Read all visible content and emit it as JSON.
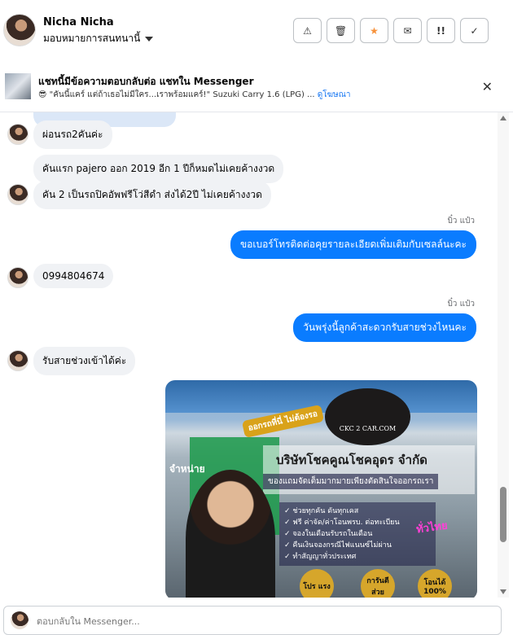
{
  "header": {
    "contact_name": "Nicha Nicha",
    "assign_label": "มอบหมายการสนทนานี้",
    "actions": [
      {
        "icon": "warning-icon",
        "glyph": "⚠"
      },
      {
        "icon": "trash-icon",
        "glyph": "🗑"
      },
      {
        "icon": "star-icon",
        "glyph": "★"
      },
      {
        "icon": "envelope-open-icon",
        "glyph": "✉"
      },
      {
        "icon": "mark-follow-up-icon",
        "glyph": "!!"
      },
      {
        "icon": "check-icon",
        "glyph": "✓"
      }
    ],
    "star_color": "#f7923b"
  },
  "banner": {
    "title": "แชทนี้มีข้อความตอบกลับต่อ แชทใน Messenger",
    "subtitle": "😎 \"คันนี้แคร์ แต่ถ้าเธอไม่มีใคร...เราพร้อมแคร์!\" Suzuki Carry 1.6 (LPG) ...",
    "link": "ดูโฆษณา",
    "close_glyph": "✕"
  },
  "messages": [
    {
      "text": "ผ่อนรถ2คันค่ะ"
    },
    {
      "text": "คันแรก pajero ออก 2019 อีก 1 ปีก็หมดไม่เคยค้างงวด"
    },
    {
      "text": "คัน 2 เป็นรถปิคอัพฟรีโว่สีดำ ส่งได้2ปี ไม่เคยค้างงวด"
    },
    {
      "sender": "บิ๋ว แป๋ว",
      "text": "ขอเบอร์โทรติดต่อคุยรายละเอียดเพิ่มเติมกับเซลล์นะคะ"
    },
    {
      "text": "0994804674"
    },
    {
      "sender": "บิ๋ว แป๋ว",
      "text": "วันพรุ่งนี้ลูกค้าสะดวกรับสายช่วงไหนคะ"
    },
    {
      "text": "รับสายช่วงเข้าได้ค่ะ"
    }
  ],
  "ad_image": {
    "logo_text": "CKC 2 CAR.COM",
    "headline": "บริษัทโชคคูณโชคอุดร จำกัด",
    "tagline": "ของแถมจัดเต็มมากมายเพียงตัดสินใจออกรถเรา",
    "badge": "ออกรถที่นี่ ไม่ต้องรอ",
    "side_text": "จำหน่าย",
    "bullets": [
      "ช่วยทุกคัน ดันทุกเคส",
      "ฟรี ค่าจัด/ค่าโอนพรบ. ต่อทะเบียน",
      "จองในเดือนรับรถในเดือน",
      "คืนเงินจองกรณีไฟแนนซ์ไม่ผ่าน",
      "ทำสัญญาทั่วประเทศ"
    ],
    "chips": [
      "โปร แรง",
      "การันตี ส่วย",
      "โอนได้ 100%"
    ],
    "purple_text": "ทั่วไทย"
  },
  "composer": {
    "placeholder": "ตอบกลับใน Messenger..."
  }
}
